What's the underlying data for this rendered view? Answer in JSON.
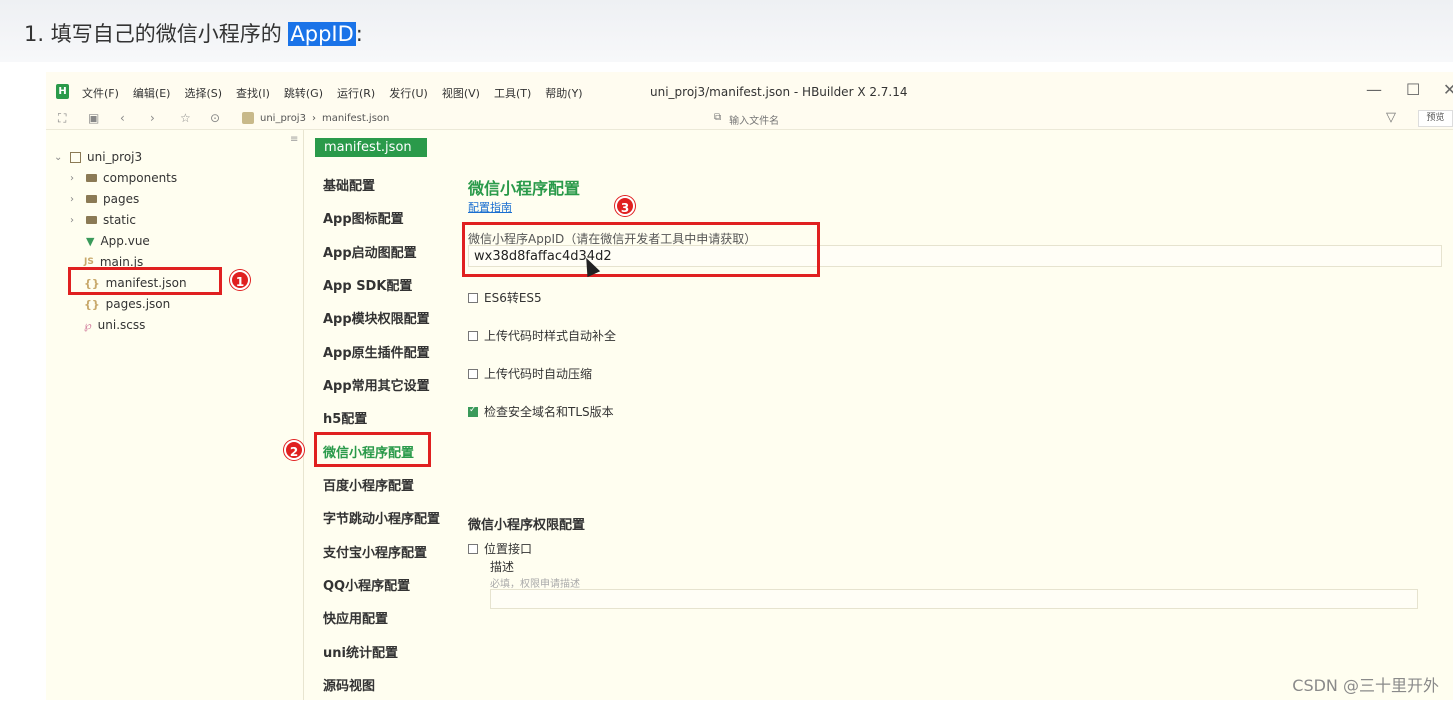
{
  "instruction": {
    "prefix": "1. 填写自己的微信小程序的 ",
    "highlight": "AppID",
    "suffix": ":"
  },
  "window": {
    "title": "uni_proj3/manifest.json - HBuilder X 2.7.14",
    "menu": [
      "文件(F)",
      "编辑(E)",
      "选择(S)",
      "查找(I)",
      "跳转(G)",
      "运行(R)",
      "发行(U)",
      "视图(V)",
      "工具(T)",
      "帮助(Y)"
    ],
    "controls": {
      "minimize": "—",
      "maximize": "☐",
      "close": "✕"
    }
  },
  "toolbar": {
    "breadcrumb": [
      "uni_proj3",
      "manifest.json"
    ],
    "file_search_placeholder": "输入文件名",
    "preview_label": "预览"
  },
  "tree": {
    "project": "uni_proj3",
    "items": [
      {
        "name": "components",
        "type": "folder"
      },
      {
        "name": "pages",
        "type": "folder"
      },
      {
        "name": "static",
        "type": "folder"
      },
      {
        "name": "App.vue",
        "type": "vue"
      },
      {
        "name": "main.js",
        "type": "js"
      },
      {
        "name": "manifest.json",
        "type": "json"
      },
      {
        "name": "pages.json",
        "type": "json"
      },
      {
        "name": "uni.scss",
        "type": "scss"
      }
    ]
  },
  "nav": {
    "tab": "manifest.json",
    "items": [
      "基础配置",
      "App图标配置",
      "App启动图配置",
      "App SDK配置",
      "App模块权限配置",
      "App原生插件配置",
      "App常用其它设置",
      "h5配置",
      "微信小程序配置",
      "百度小程序配置",
      "字节跳动小程序配置",
      "支付宝小程序配置",
      "QQ小程序配置",
      "快应用配置",
      "uni统计配置",
      "源码视图"
    ],
    "active_index": 8
  },
  "content": {
    "section_title": "微信小程序配置",
    "guide_link": "配置指南",
    "appid_label": "微信小程序AppID（请在微信开发者工具中申请获取）",
    "appid_value": "wx38d8faffac4d34d2",
    "options": [
      {
        "label": "ES6转ES5",
        "checked": false
      },
      {
        "label": "上传代码时样式自动补全",
        "checked": false
      },
      {
        "label": "上传代码时自动压缩",
        "checked": false
      },
      {
        "label": "检查安全域名和TLS版本",
        "checked": true
      }
    ],
    "perm_title": "微信小程序权限配置",
    "location_label": "位置接口",
    "desc_label": "描述",
    "desc_placeholder": "必填，权限申请描述"
  },
  "annotations": {
    "badge1": "1",
    "badge2": "2",
    "badge3": "3"
  },
  "watermark": "CSDN @三十里开外",
  "colors": {
    "accent": "#2a9a4a",
    "annotation": "#e02020",
    "highlight": "#1a73e8"
  }
}
